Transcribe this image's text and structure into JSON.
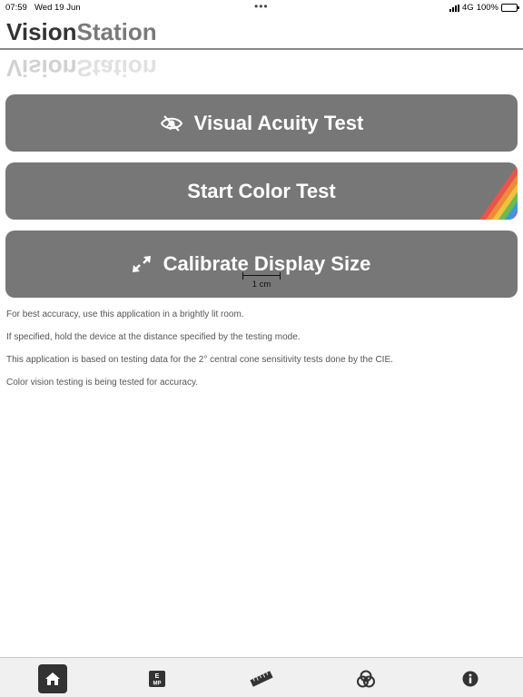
{
  "status_bar": {
    "time": "07:59",
    "date": "Wed 19 Jun",
    "network": "4G",
    "battery": "100%",
    "battery_level": 1.0
  },
  "header": {
    "title_part1": "Vision",
    "title_part2": "Station"
  },
  "buttons": {
    "acuity": {
      "label": "Visual Acuity Test",
      "icon": "eye-slash-icon"
    },
    "color": {
      "label": "Start Color Test",
      "decoration": "rainbow-stripes"
    },
    "calibrate": {
      "label": "Calibrate Display Size",
      "icon": "resize-arrows-icon",
      "scale_label": "1 cm"
    }
  },
  "notes": [
    "For best accuracy, use this application in a brightly lit room.",
    "If specified, hold the device at the distance specified by the testing mode.",
    "This application is based on testing data for the 2° central cone sensitivity tests done by the CIE.",
    "Color vision testing is being tested for accuracy."
  ],
  "tabbar": {
    "items": [
      {
        "name": "home",
        "icon": "home-icon",
        "active": true
      },
      {
        "name": "eye-chart",
        "icon": "eye-chart-icon",
        "glyph_top": "E",
        "glyph_bottom": "MP",
        "active": false
      },
      {
        "name": "ruler",
        "icon": "ruler-icon",
        "active": false
      },
      {
        "name": "color",
        "icon": "color-circles-icon",
        "active": false
      },
      {
        "name": "info",
        "icon": "info-icon",
        "active": false
      }
    ]
  },
  "colors": {
    "button_bg": "#777777",
    "title_dark": "#333333",
    "title_light": "#7a7a7a",
    "rainbow": [
      "#e8554d",
      "#f08a3a",
      "#eec23c",
      "#6dbb4c",
      "#3b9bd8",
      "#9a6ad0"
    ]
  }
}
